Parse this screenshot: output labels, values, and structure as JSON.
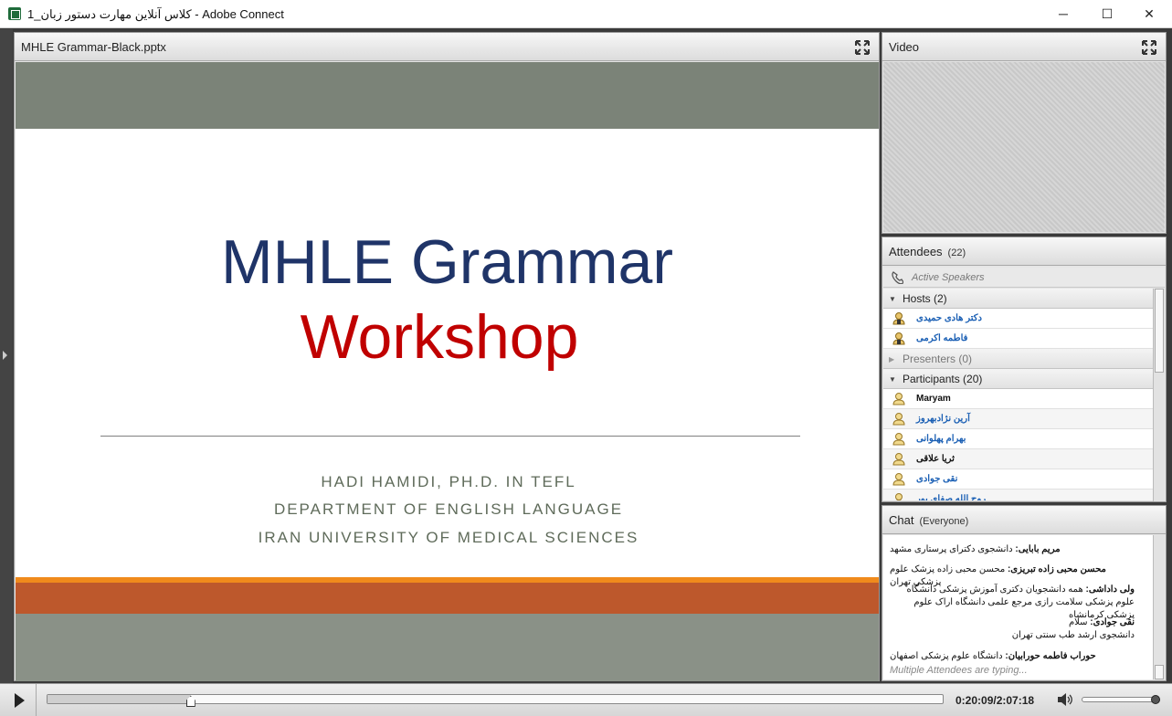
{
  "window": {
    "title": "کلاس آنلاین مهارت دستور زبان_1 - Adobe Connect",
    "minimize": "─",
    "maximize": "☐",
    "close": "✕"
  },
  "share_pod": {
    "title": "MHLE Grammar-Black.pptx",
    "slide": {
      "title_line1": "MHLE Grammar",
      "title_line2": "Workshop",
      "sub1": "HADI HAMIDI, PH.D. IN TEFL",
      "sub2": "DEPARTMENT OF ENGLISH LANGUAGE",
      "sub3": "IRAN UNIVERSITY OF MEDICAL SCIENCES"
    }
  },
  "video_pod": {
    "title": "Video"
  },
  "attendees_pod": {
    "title": "Attendees",
    "count": "(22)",
    "active_speakers": "Active Speakers",
    "hosts_label": "Hosts (2)",
    "hosts": [
      "دکتر هادی حمیدی",
      "فاطمه اکرمی"
    ],
    "presenters_label": "Presenters (0)",
    "participants_label": "Participants (20)",
    "participants": [
      "Maryam",
      "آرین نژادبهروز",
      "بهرام پهلوانی",
      "ثریا علاقی",
      "نقی جوادی",
      "روح الله صفای پور"
    ]
  },
  "chat_pod": {
    "title": "Chat",
    "scope": "(Everyone)",
    "messages": [
      {
        "sender": "مریم بابایی:",
        "text": "دانشجوی دکترای پرستاری مشهد"
      },
      {
        "sender": "محسن محبی زاده تبریزی:",
        "text": "محسن محبی زاده پزشک علوم پزشکی تهران"
      },
      {
        "sender": "ولی داداشی:",
        "text": "همه دانشجویان دکتری آموزش پزشکی دانشگاه علوم پزشکی سلامت رازی مرجع علمی دانشگاه اراک علوم پزشکی کرمانشاه"
      },
      {
        "sender": "نقی جوادی:",
        "text": "سلام\nدانشجوی ارشد طب سنتی تهران"
      },
      {
        "sender": "حوراب فاطمه حورابیان:",
        "text": "دانشگاه علوم پزشکی اصفهان"
      }
    ],
    "typing": "Multiple Attendees are typing..."
  },
  "controls": {
    "time": "0:20:09/2:07:18",
    "progress": 0.16,
    "volume": 1.0
  }
}
